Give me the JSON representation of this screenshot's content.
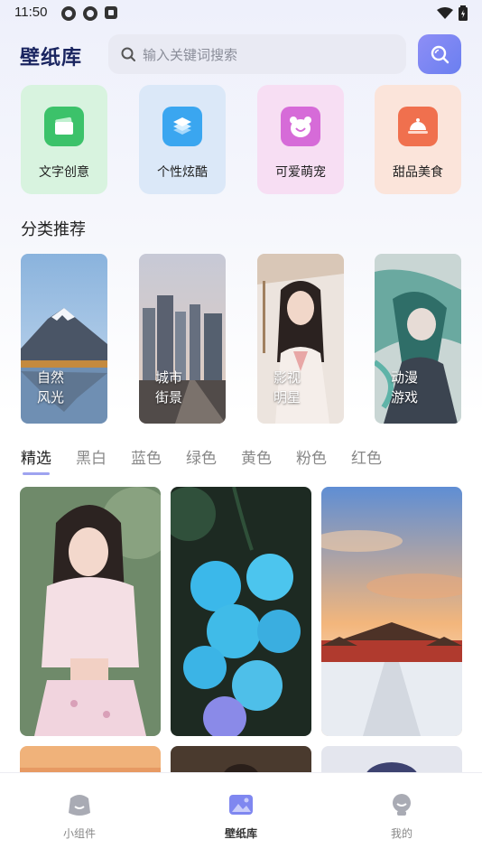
{
  "status_bar": {
    "time": "11:50"
  },
  "header": {
    "logo": "壁纸库",
    "search_placeholder": "输入关键词搜索"
  },
  "categories": [
    {
      "label": "文字创意",
      "icon": "text-card-icon",
      "color": "#3cc26a"
    },
    {
      "label": "个性炫酷",
      "icon": "layers-icon",
      "color": "#3aa6f0"
    },
    {
      "label": "可爱萌宠",
      "icon": "pet-face-icon",
      "color": "#d66bd8"
    },
    {
      "label": "甜品美食",
      "icon": "food-dome-icon",
      "color": "#f0704e"
    }
  ],
  "section_title": "分类推荐",
  "recommendations": [
    {
      "line1": "自然",
      "line2": "风光"
    },
    {
      "line1": "城市",
      "line2": "街景"
    },
    {
      "line1": "影视",
      "line2": "明星"
    },
    {
      "line1": "动漫",
      "line2": "游戏"
    }
  ],
  "tabs": [
    "精选",
    "黑白",
    "蓝色",
    "绿色",
    "黄色",
    "粉色",
    "红色"
  ],
  "bottom_nav": [
    {
      "label": "小组件"
    },
    {
      "label": "壁纸库"
    },
    {
      "label": "我的"
    }
  ]
}
